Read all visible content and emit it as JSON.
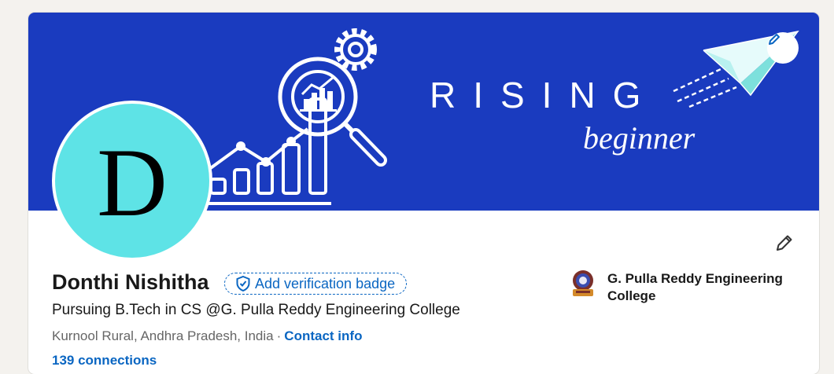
{
  "banner": {
    "title": "RISING",
    "subtitle": "beginner"
  },
  "profile": {
    "avatar_initial": "D",
    "name": "Donthi Nishitha",
    "verification_label": "Add verification badge",
    "headline": "Pursuing B.Tech in CS @G. Pulla Reddy Engineering College",
    "location": "Kurnool Rural, Andhra Pradesh, India",
    "separator": "·",
    "contact_label": "Contact info",
    "connections_label": "139 connections"
  },
  "education": {
    "name": "G. Pulla Reddy Engineering College",
    "logo_icon": "college-crest-icon"
  },
  "icons": {
    "edit_banner": "pencil-icon",
    "edit_intro": "pencil-icon",
    "verification": "shield-check-icon"
  },
  "colors": {
    "banner_bg": "#1a3bbf",
    "avatar_bg": "#5ee3e6",
    "link": "#0a66c2",
    "page_bg": "#f4f2ee"
  }
}
